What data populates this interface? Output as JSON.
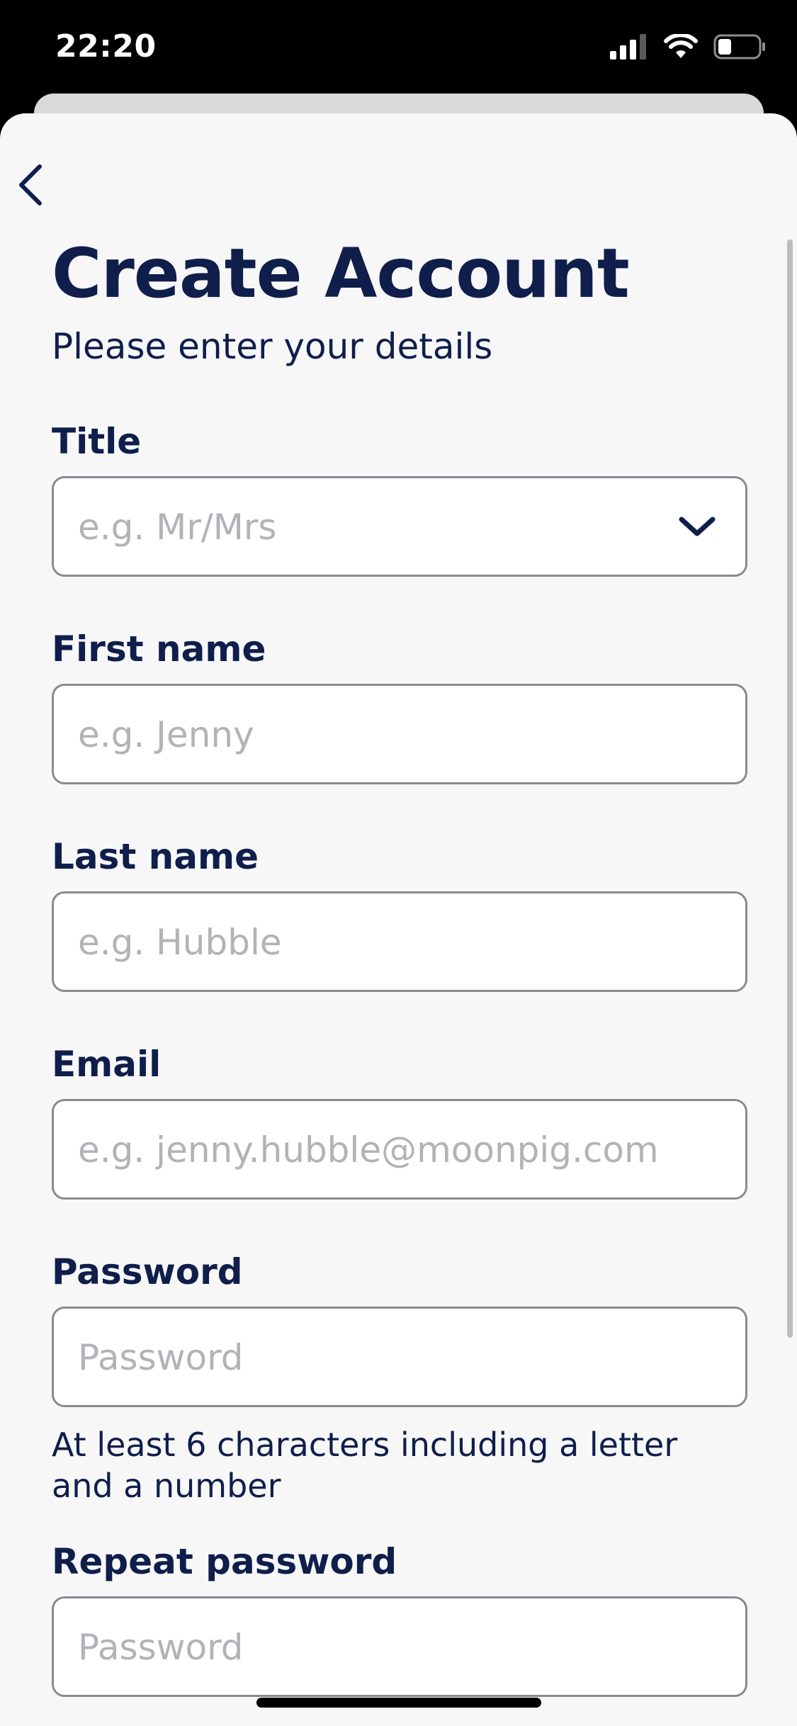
{
  "status_bar": {
    "time": "22:20",
    "icons": [
      "signal-icon",
      "wifi-icon",
      "battery-icon"
    ]
  },
  "header": {
    "back_icon": "chevron-left-icon",
    "title": "Create Account",
    "subtitle": "Please enter your details"
  },
  "form": {
    "title": {
      "label": "Title",
      "placeholder": "e.g. Mr/Mrs",
      "value": "",
      "icon": "chevron-down-icon"
    },
    "first_name": {
      "label": "First name",
      "placeholder": "e.g. Jenny",
      "value": ""
    },
    "last_name": {
      "label": "Last name",
      "placeholder": "e.g. Hubble",
      "value": ""
    },
    "email": {
      "label": "Email",
      "placeholder": "e.g. jenny.hubble@moonpig.com",
      "value": ""
    },
    "password": {
      "label": "Password",
      "placeholder": "Password",
      "value": "",
      "helper": "At least 6 characters including a letter and a number"
    },
    "repeat_password": {
      "label": "Repeat password",
      "placeholder": "Password",
      "value": ""
    }
  },
  "colors": {
    "text_primary": "#0f1e4b",
    "placeholder": "#b2b2b8",
    "field_border": "#8a8a92",
    "sheet_background": "#f7f7f8"
  }
}
